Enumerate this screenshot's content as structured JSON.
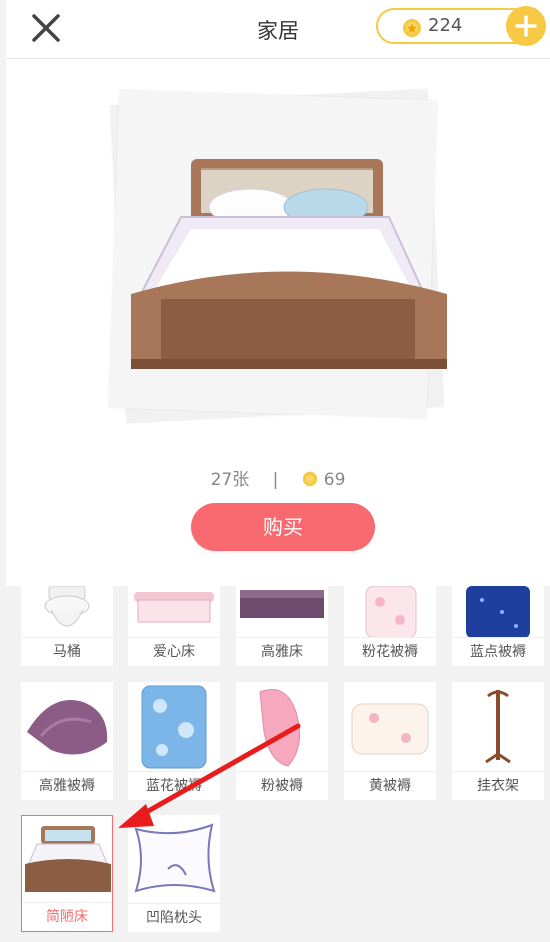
{
  "header": {
    "title": "家居",
    "coins": "224"
  },
  "preview": {
    "count": "27张",
    "separator": "|",
    "price": "69",
    "buy_label": "购买"
  },
  "grid": {
    "row1": [
      "马桶",
      "爱心床",
      "高雅床",
      "粉花被褥",
      "蓝点被褥"
    ],
    "row2": [
      "高雅被褥",
      "蓝花被褥",
      "粉被褥",
      "黄被褥",
      "挂衣架"
    ],
    "row3": [
      "简陋床",
      "凹陷枕头"
    ]
  },
  "colors": {
    "accent": "#f86a6f",
    "coin": "#f7c844"
  }
}
